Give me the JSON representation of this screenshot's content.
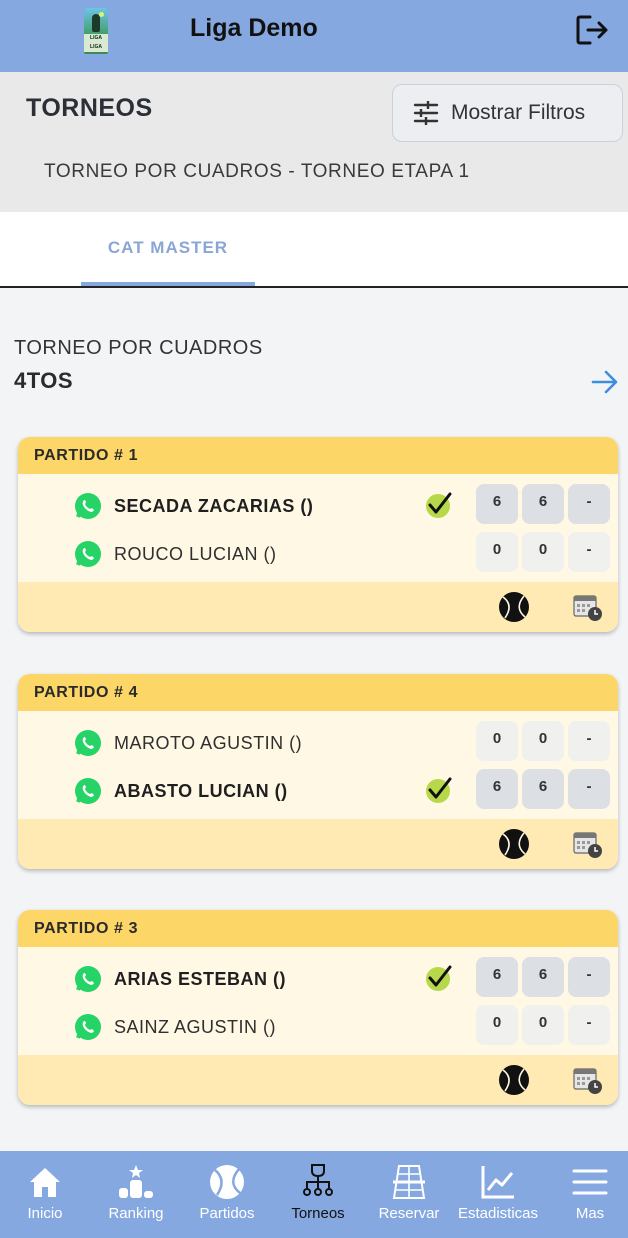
{
  "header": {
    "title": "Liga Demo",
    "logo_text": "LIGA LIGA"
  },
  "section": {
    "title": "TORNEOS",
    "filter_label": "Mostrar Filtros",
    "subtitle": "TORNEO POR CUADROS - TORNEO ETAPA 1"
  },
  "tabs": [
    {
      "label": "CAT MASTER",
      "active": true
    }
  ],
  "round": {
    "type": "TORNEO POR CUADROS",
    "name": "4TOS"
  },
  "matches": [
    {
      "title": "PARTIDO # 1",
      "players": [
        {
          "name": "SECADA ZACARIAS ()",
          "winner": true,
          "scores": [
            "6",
            "6",
            "-"
          ]
        },
        {
          "name": "ROUCO LUCIAN ()",
          "winner": false,
          "scores": [
            "0",
            "0",
            "-"
          ]
        }
      ]
    },
    {
      "title": "PARTIDO # 4",
      "players": [
        {
          "name": "MAROTO AGUSTIN ()",
          "winner": false,
          "scores": [
            "0",
            "0",
            "-"
          ]
        },
        {
          "name": "ABASTO LUCIAN ()",
          "winner": true,
          "scores": [
            "6",
            "6",
            "-"
          ]
        }
      ]
    },
    {
      "title": "PARTIDO # 3",
      "players": [
        {
          "name": "ARIAS ESTEBAN ()",
          "winner": true,
          "scores": [
            "6",
            "6",
            "-"
          ]
        },
        {
          "name": "SAINZ AGUSTIN ()",
          "winner": false,
          "scores": [
            "0",
            "0",
            "-"
          ]
        }
      ]
    }
  ],
  "nav": [
    {
      "label": "Inicio",
      "icon": "home-icon"
    },
    {
      "label": "Ranking",
      "icon": "ranking-icon"
    },
    {
      "label": "Partidos",
      "icon": "ball-icon"
    },
    {
      "label": "Torneos",
      "icon": "bracket-icon",
      "active": true
    },
    {
      "label": "Reservar",
      "icon": "court-icon"
    },
    {
      "label": "Estadisticas",
      "icon": "chart-icon"
    },
    {
      "label": "Mas",
      "icon": "menu-icon"
    }
  ],
  "colors": {
    "header": "#86a8e0",
    "card_head": "#fdd668",
    "card_body": "#fef8e4",
    "card_foot": "#feeab2",
    "tab_text": "#8aa6d4",
    "arrow": "#3b8fe0"
  }
}
